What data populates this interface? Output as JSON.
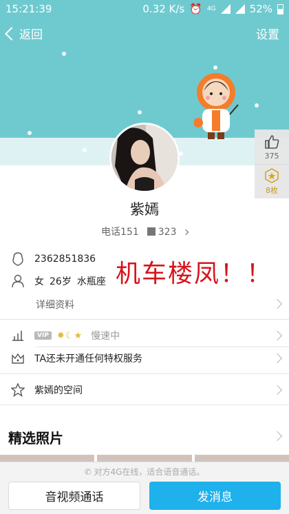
{
  "status_bar": {
    "time": "15:21:39",
    "speed": "0.32 K/s",
    "network": "4G",
    "battery": "52%"
  },
  "nav": {
    "back_label": "返回",
    "settings_label": "设置"
  },
  "side_panel": {
    "likes": "375",
    "badges": "8枚"
  },
  "profile": {
    "name": "紫嫣",
    "phone_prefix": "电话151",
    "phone_suffix": "323"
  },
  "info": {
    "qq_number": "2362851836",
    "gender": "女",
    "age": "26岁",
    "zodiac": "水瓶座",
    "detail_label": "详细资料"
  },
  "overlay_text": "机车楼凤！！",
  "vip": {
    "tag": "VIP",
    "icons": "✹☾★",
    "speed_label": "慢速中"
  },
  "privilege": {
    "label": "TA还未开通任何特权服务"
  },
  "space": {
    "label": "紫嫣的空间"
  },
  "photos": {
    "title": "精选照片"
  },
  "bottom": {
    "hint": "对方4G在线，适合语音通话。",
    "av_call_label": "音视频通话",
    "message_label": "发消息"
  },
  "colors": {
    "banner": "#6fcad0",
    "accent": "#1fb1eb",
    "overlay_red": "#d8141b"
  }
}
